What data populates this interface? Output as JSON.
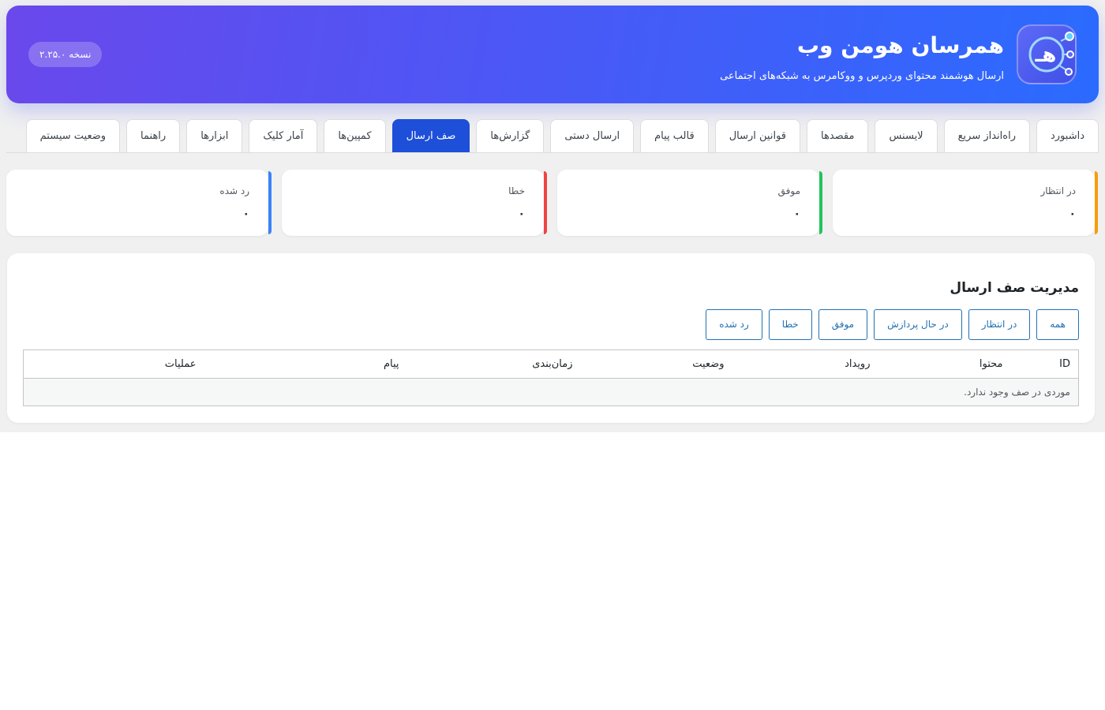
{
  "header": {
    "title": "همرسان هومن وب",
    "subtitle": "ارسال هوشمند محتوای وردپرس و ووکامرس به شبکه‌های اجتماعی",
    "version": "نسخه ۲.۲۵.۰",
    "logo_icon": "share-network-logo-icon",
    "gradient_colors": [
      "#6a48ec",
      "#2b6bff"
    ]
  },
  "tabs": [
    {
      "label": "داشبورد",
      "active": false
    },
    {
      "label": "راه‌انداز سریع",
      "active": false
    },
    {
      "label": "لایسنس",
      "active": false
    },
    {
      "label": "مقصدها",
      "active": false
    },
    {
      "label": "قوانین ارسال",
      "active": false
    },
    {
      "label": "قالب پیام",
      "active": false
    },
    {
      "label": "ارسال دستی",
      "active": false
    },
    {
      "label": "گزارش‌ها",
      "active": false
    },
    {
      "label": "صف ارسال",
      "active": true
    },
    {
      "label": "کمپین‌ها",
      "active": false
    },
    {
      "label": "آمار کلیک",
      "active": false
    },
    {
      "label": "ابزارها",
      "active": false
    },
    {
      "label": "راهنما",
      "active": false
    },
    {
      "label": "وضعیت سیستم",
      "active": false
    }
  ],
  "stats": [
    {
      "label": "در انتظار",
      "value": "۰",
      "color": "#f59e0b"
    },
    {
      "label": "موفق",
      "value": "۰",
      "color": "#22c55e"
    },
    {
      "label": "خطا",
      "value": "۰",
      "color": "#ef4444"
    },
    {
      "label": "رد شده",
      "value": "۰",
      "color": "#3b82f6"
    }
  ],
  "queue": {
    "title": "مدیریت صف ارسال",
    "filters": [
      "همه",
      "در انتظار",
      "در حال پردازش",
      "موفق",
      "خطا",
      "رد شده"
    ],
    "columns": [
      "ID",
      "محتوا",
      "رویداد",
      "وضعیت",
      "زمان‌بندی",
      "پیام",
      "عملیات"
    ],
    "empty_message": "موردی در صف وجود ندارد."
  },
  "accent_color": "#1d4fd8"
}
